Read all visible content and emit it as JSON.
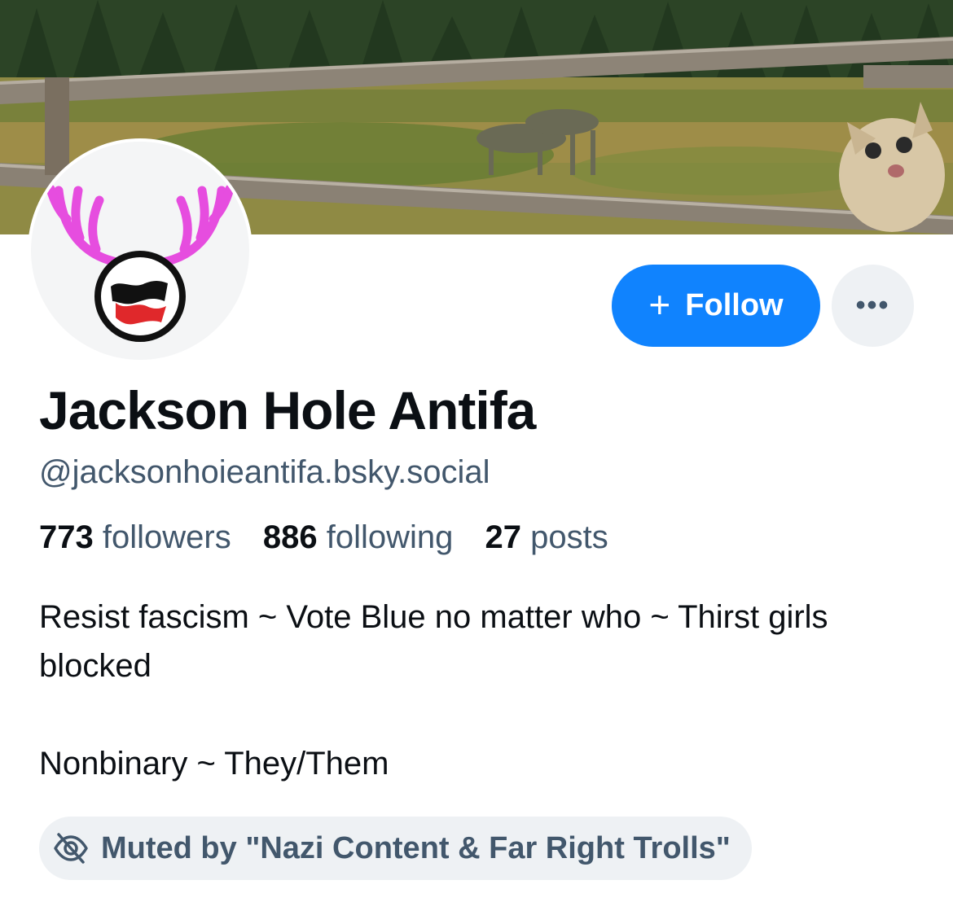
{
  "profile": {
    "display_name": "Jackson Hole Antifa",
    "handle": "@jacksonhoieantifa.bsky.social",
    "stats": {
      "followers_count": "773",
      "followers_label": "followers",
      "following_count": "886",
      "following_label": "following",
      "posts_count": "27",
      "posts_label": "posts"
    },
    "bio_line1": "Resist fascism ~ Vote Blue no matter who ~ Thirst girls blocked",
    "bio_line2": "Nonbinary ~ They/Them",
    "mute_label": "Muted by \"Nazi Content & Far Right Trolls\""
  },
  "actions": {
    "follow_icon": "+",
    "follow_label": "Follow",
    "more_label": "•••"
  },
  "icons": {
    "mute": "eye-slash-icon",
    "more": "ellipsis-icon",
    "follow": "plus-icon"
  },
  "colors": {
    "accent": "#1083fe",
    "muted_text": "#42576c",
    "pill_bg": "#eef1f4",
    "antlers": "#e64ddf"
  }
}
